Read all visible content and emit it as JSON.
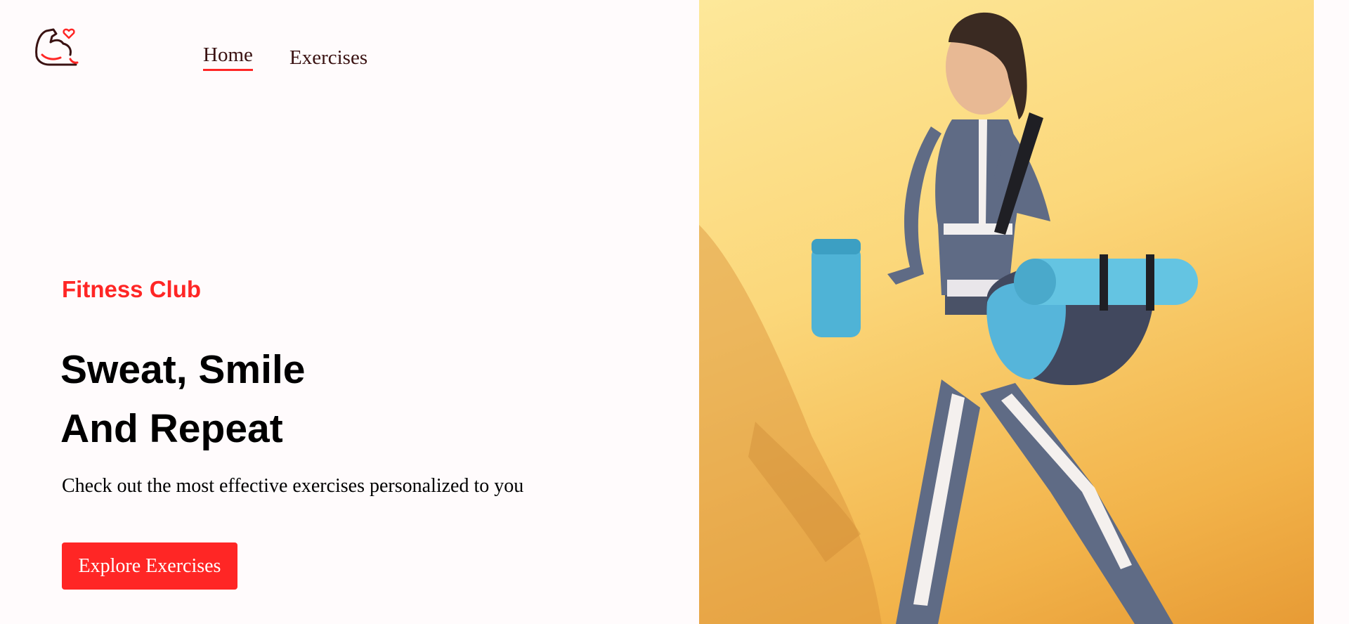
{
  "nav": {
    "logo_icon": "flexed-bicep-heart-icon",
    "home_label": "Home",
    "exercises_label": "Exercises"
  },
  "hero": {
    "tagline": "Fitness Club",
    "headline_line1": "Sweat, Smile",
    "headline_line2": "And Repeat",
    "subtext": "Check out the most effective exercises personalized to you",
    "cta_label": "Explore Exercises",
    "image_icon": "woman-walking-with-gym-bag-photo"
  },
  "colors": {
    "accent": "#FF2625",
    "nav_text": "#3A1212",
    "background": "#FFFBFC",
    "image_bg": "#FBD77A"
  }
}
